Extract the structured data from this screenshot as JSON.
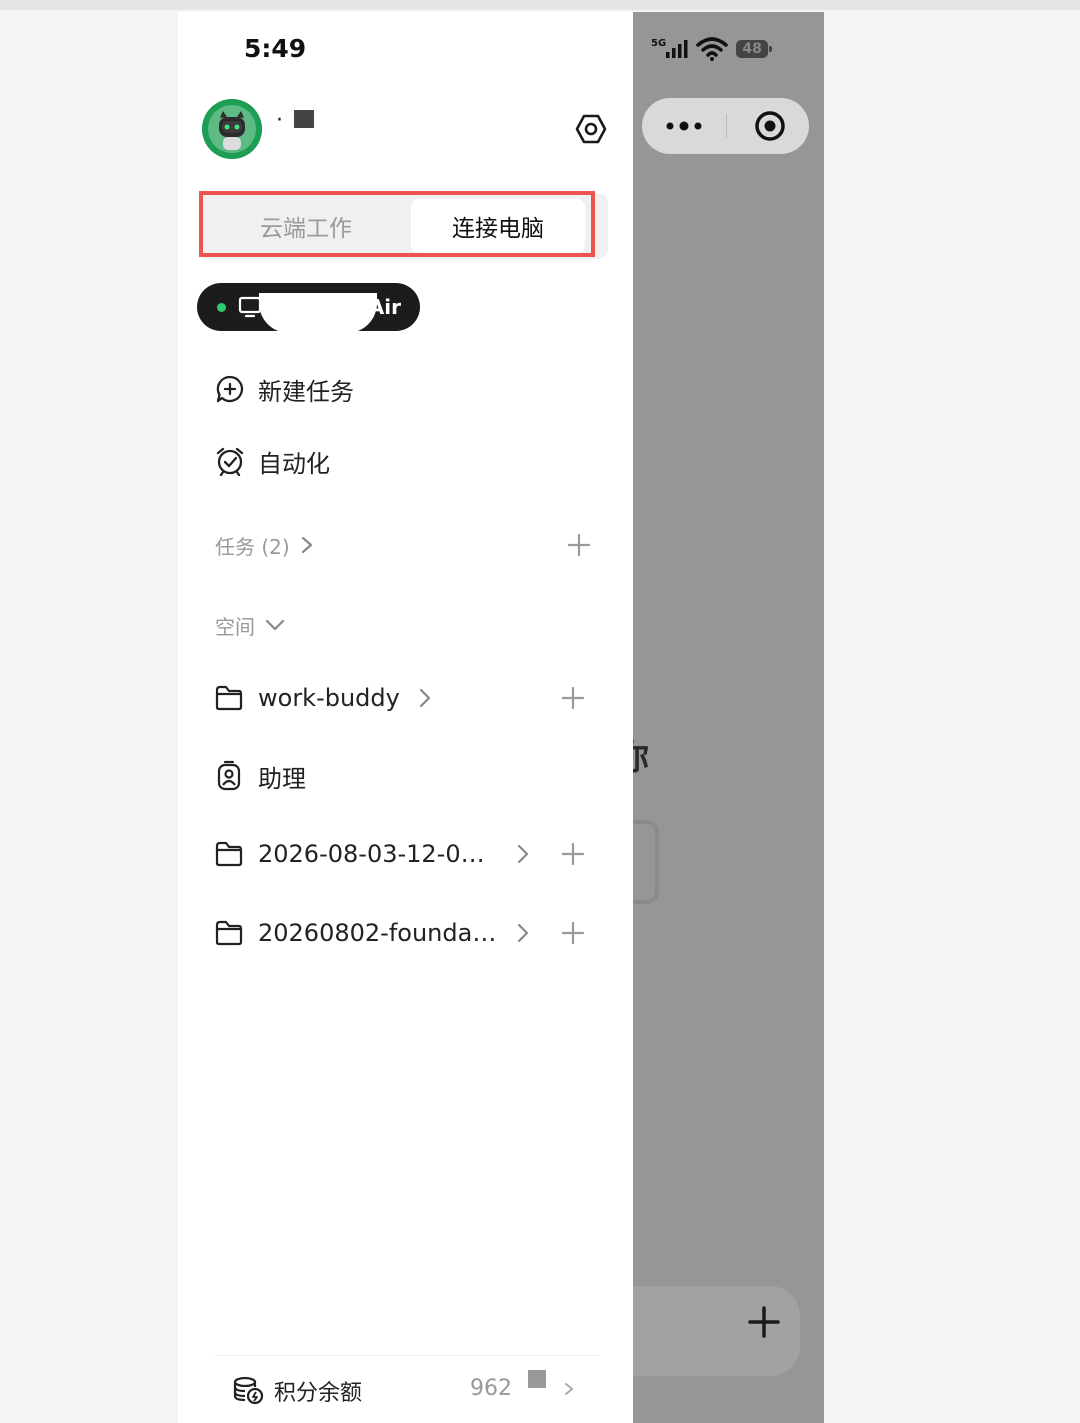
{
  "status_bar": {
    "time": "5:49",
    "network": "5G",
    "battery": "48"
  },
  "user": {
    "name": "·"
  },
  "segment": {
    "tabs": [
      "云端工作",
      "连接电脑"
    ],
    "active_tab": "连接电脑"
  },
  "device": {
    "name_visible": "eAir",
    "status_color": "#2ecc71"
  },
  "menu": {
    "new_task": "新建任务",
    "automation": "自动化"
  },
  "tasks": {
    "label": "任务 (2)"
  },
  "spaces": {
    "label": "空间",
    "items": [
      {
        "type": "folder",
        "label": "work-buddy",
        "icon": "folder-icon"
      },
      {
        "type": "assistant",
        "label": "助理",
        "icon": "badge-icon"
      },
      {
        "type": "folder",
        "label": "2026-08-03-12-0…",
        "icon": "folder-icon"
      },
      {
        "type": "folder",
        "label": "20260802-founda…",
        "icon": "folder-icon"
      }
    ]
  },
  "footer": {
    "credits_label": "积分余额",
    "credits_value": "962"
  },
  "background": {
    "greeting_fragment": "你"
  },
  "colors": {
    "accent": "#ef5350",
    "drawer_bg": "#ffffff",
    "overlay": "#969696"
  }
}
